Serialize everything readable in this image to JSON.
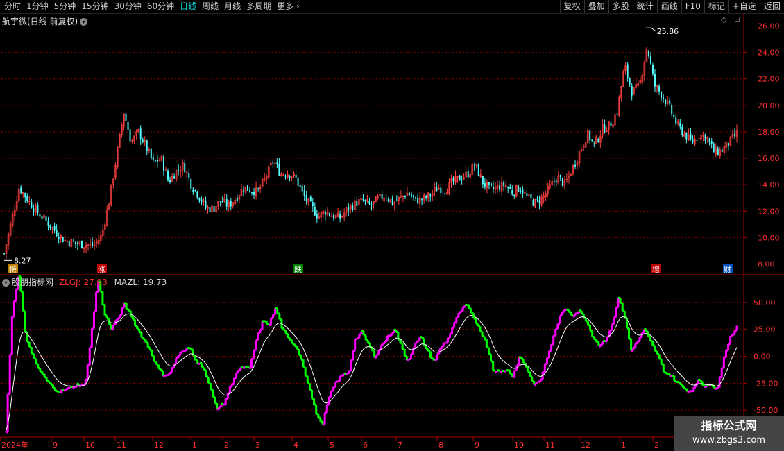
{
  "toolbar": {
    "periods": [
      "分时",
      "1分钟",
      "5分钟",
      "15分钟",
      "30分钟",
      "60分钟",
      "日线",
      "周线",
      "月线",
      "多周期",
      "更多"
    ],
    "active_period": "日线",
    "more_arrow": "›",
    "buttons": [
      "复权",
      "叠加",
      "多股",
      "统计",
      "画线",
      "F10",
      "标记",
      "+自选",
      "返回"
    ]
  },
  "main_panel": {
    "title": "航宇微(日线 前复权)",
    "high_label": "25.86",
    "low_label": "8.27",
    "y_ticks": [
      "26.00",
      "24.00",
      "22.00",
      "20.00",
      "18.00",
      "16.00",
      "14.00",
      "12.00",
      "10.00",
      "8.00"
    ],
    "events": [
      "榜",
      "涨",
      "跌",
      "增",
      "财"
    ]
  },
  "indicator_panel": {
    "name": "股朋指标网",
    "zlgj_label": "ZLGJ: 27.93",
    "mazl_label": "MAZL: 19.73",
    "y_ticks": [
      "50.00",
      "25.00",
      "0.00",
      "-25.00",
      "-50.00"
    ]
  },
  "x_axis": {
    "labels": [
      "2024年",
      "9",
      "10",
      "11",
      "12",
      "1",
      "2",
      "3",
      "4",
      "5",
      "6",
      "7",
      "8",
      "9",
      "10",
      "11",
      "12",
      "1",
      "2"
    ]
  },
  "watermark": {
    "line1": "指标公式网",
    "line2": "www.zbgs3.com"
  },
  "colors": {
    "up": "#ff4040",
    "down": "#54ffff",
    "osc_up": "#ff00ff",
    "osc_down": "#00ff00",
    "grid": "#8b0000"
  },
  "chart_data": [
    {
      "type": "candlestick",
      "title": "航宇微(日线 前复权)",
      "ylim": [
        7.5,
        26.5
      ],
      "y_ticks": [
        26,
        24,
        22,
        20,
        18,
        16,
        14,
        12,
        10,
        8
      ],
      "x_ticks": [
        "2024年",
        "9",
        "10",
        "11",
        "12",
        "1",
        "2",
        "3",
        "4",
        "5",
        "6",
        "7",
        "8",
        "9",
        "10",
        "11",
        "12",
        "1",
        "2"
      ],
      "close_path": [
        [
          0,
          8.8
        ],
        [
          10,
          13.8
        ],
        [
          20,
          12.2
        ],
        [
          30,
          11.0
        ],
        [
          40,
          9.8
        ],
        [
          50,
          9.5
        ],
        [
          60,
          9.4
        ],
        [
          65,
          10.1
        ],
        [
          70,
          12.6
        ],
        [
          75,
          16.0
        ],
        [
          80,
          19.5
        ],
        [
          85,
          17.2
        ],
        [
          90,
          18.0
        ],
        [
          95,
          16.8
        ],
        [
          100,
          15.6
        ],
        [
          105,
          16.0
        ],
        [
          110,
          14.2
        ],
        [
          115,
          15.0
        ],
        [
          120,
          15.5
        ],
        [
          125,
          14.0
        ],
        [
          130,
          13.2
        ],
        [
          135,
          12.2
        ],
        [
          140,
          12.2
        ],
        [
          145,
          12.8
        ],
        [
          150,
          12.4
        ],
        [
          155,
          13.0
        ],
        [
          160,
          13.8
        ],
        [
          165,
          13.6
        ],
        [
          170,
          13.5
        ],
        [
          175,
          14.6
        ],
        [
          180,
          15.8
        ],
        [
          185,
          14.8
        ],
        [
          190,
          14.9
        ],
        [
          195,
          14.5
        ],
        [
          200,
          13.2
        ],
        [
          205,
          12.4
        ],
        [
          210,
          11.6
        ],
        [
          215,
          12.0
        ],
        [
          220,
          11.6
        ],
        [
          225,
          11.5
        ],
        [
          230,
          12.2
        ],
        [
          235,
          12.6
        ],
        [
          240,
          12.8
        ],
        [
          245,
          12.4
        ],
        [
          250,
          12.9
        ],
        [
          255,
          13.2
        ],
        [
          260,
          12.6
        ],
        [
          265,
          13.0
        ],
        [
          270,
          13.4
        ],
        [
          275,
          12.8
        ],
        [
          280,
          12.9
        ],
        [
          285,
          13.2
        ],
        [
          290,
          13.8
        ],
        [
          295,
          13.6
        ],
        [
          300,
          14.2
        ],
        [
          305,
          14.5
        ],
        [
          310,
          14.8
        ],
        [
          315,
          15.5
        ],
        [
          320,
          14.2
        ],
        [
          325,
          13.6
        ],
        [
          330,
          13.8
        ],
        [
          335,
          14.0
        ],
        [
          340,
          13.4
        ],
        [
          345,
          13.8
        ],
        [
          350,
          13.0
        ],
        [
          355,
          12.6
        ],
        [
          360,
          13.0
        ],
        [
          365,
          13.8
        ],
        [
          370,
          14.6
        ],
        [
          375,
          14.0
        ],
        [
          380,
          15.2
        ],
        [
          385,
          16.5
        ],
        [
          390,
          17.8
        ],
        [
          395,
          17.0
        ],
        [
          400,
          18.2
        ],
        [
          405,
          18.5
        ],
        [
          410,
          19.5
        ],
        [
          415,
          23.0
        ],
        [
          420,
          21.0
        ],
        [
          425,
          21.5
        ],
        [
          430,
          24.5
        ],
        [
          435,
          21.5
        ],
        [
          440,
          20.8
        ],
        [
          445,
          19.8
        ],
        [
          450,
          18.5
        ],
        [
          455,
          17.8
        ],
        [
          460,
          17.2
        ],
        [
          465,
          17.8
        ],
        [
          470,
          17.6
        ],
        [
          475,
          16.4
        ],
        [
          480,
          16.6
        ],
        [
          485,
          17.2
        ],
        [
          490,
          17.9
        ]
      ],
      "high": 25.86,
      "low": 8.27
    },
    {
      "type": "line",
      "title": "股朋指标网",
      "ylim": [
        -75,
        75
      ],
      "y_ticks": [
        50,
        25,
        0,
        -25,
        -50
      ],
      "series": [
        {
          "name": "ZLGJ",
          "last": 27.93,
          "values": [
            [
              0,
              -70
            ],
            [
              4,
              40
            ],
            [
              8,
              75
            ],
            [
              12,
              20
            ],
            [
              16,
              0
            ],
            [
              20,
              -12
            ],
            [
              26,
              -25
            ],
            [
              32,
              -33
            ],
            [
              38,
              -30
            ],
            [
              44,
              -26
            ],
            [
              48,
              -28
            ],
            [
              52,
              20
            ],
            [
              56,
              72
            ],
            [
              60,
              40
            ],
            [
              64,
              25
            ],
            [
              68,
              35
            ],
            [
              72,
              48
            ],
            [
              76,
              38
            ],
            [
              80,
              25
            ],
            [
              84,
              15
            ],
            [
              88,
              5
            ],
            [
              92,
              -10
            ],
            [
              96,
              -18
            ],
            [
              100,
              -15
            ],
            [
              104,
              0
            ],
            [
              108,
              5
            ],
            [
              112,
              8
            ],
            [
              116,
              -5
            ],
            [
              120,
              -10
            ],
            [
              124,
              -30
            ],
            [
              128,
              -48
            ],
            [
              132,
              -45
            ],
            [
              136,
              -30
            ],
            [
              140,
              -15
            ],
            [
              144,
              -10
            ],
            [
              148,
              -12
            ],
            [
              152,
              15
            ],
            [
              156,
              32
            ],
            [
              160,
              30
            ],
            [
              164,
              45
            ],
            [
              168,
              25
            ],
            [
              172,
              15
            ],
            [
              176,
              10
            ],
            [
              180,
              -5
            ],
            [
              184,
              -28
            ],
            [
              188,
              -50
            ],
            [
              192,
              -65
            ],
            [
              196,
              -40
            ],
            [
              200,
              -25
            ],
            [
              204,
              -18
            ],
            [
              208,
              -15
            ],
            [
              212,
              15
            ],
            [
              216,
              22
            ],
            [
              220,
              12
            ],
            [
              224,
              0
            ],
            [
              228,
              10
            ],
            [
              232,
              18
            ],
            [
              236,
              26
            ],
            [
              240,
              10
            ],
            [
              244,
              -5
            ],
            [
              248,
              10
            ],
            [
              252,
              18
            ],
            [
              256,
              5
            ],
            [
              260,
              -5
            ],
            [
              264,
              8
            ],
            [
              268,
              15
            ],
            [
              272,
              30
            ],
            [
              276,
              42
            ],
            [
              280,
              48
            ],
            [
              284,
              35
            ],
            [
              288,
              25
            ],
            [
              292,
              10
            ],
            [
              296,
              -12
            ],
            [
              300,
              -15
            ],
            [
              304,
              -12
            ],
            [
              308,
              -18
            ],
            [
              312,
              0
            ],
            [
              316,
              -10
            ],
            [
              320,
              -25
            ],
            [
              324,
              -25
            ],
            [
              328,
              -5
            ],
            [
              332,
              15
            ],
            [
              336,
              35
            ],
            [
              340,
              45
            ],
            [
              344,
              38
            ],
            [
              348,
              42
            ],
            [
              352,
              35
            ],
            [
              356,
              20
            ],
            [
              360,
              10
            ],
            [
              364,
              15
            ],
            [
              368,
              28
            ],
            [
              372,
              55
            ],
            [
              376,
              35
            ],
            [
              380,
              5
            ],
            [
              384,
              15
            ],
            [
              388,
              25
            ],
            [
              392,
              12
            ],
            [
              396,
              0
            ],
            [
              400,
              -15
            ],
            [
              404,
              -18
            ],
            [
              408,
              -25
            ],
            [
              412,
              -30
            ],
            [
              416,
              -33
            ],
            [
              420,
              -22
            ],
            [
              424,
              -28
            ],
            [
              428,
              -25
            ],
            [
              432,
              -32
            ],
            [
              436,
              0
            ],
            [
              440,
              18
            ],
            [
              444,
              28
            ]
          ]
        },
        {
          "name": "MAZL",
          "last": 19.73
        }
      ]
    }
  ]
}
